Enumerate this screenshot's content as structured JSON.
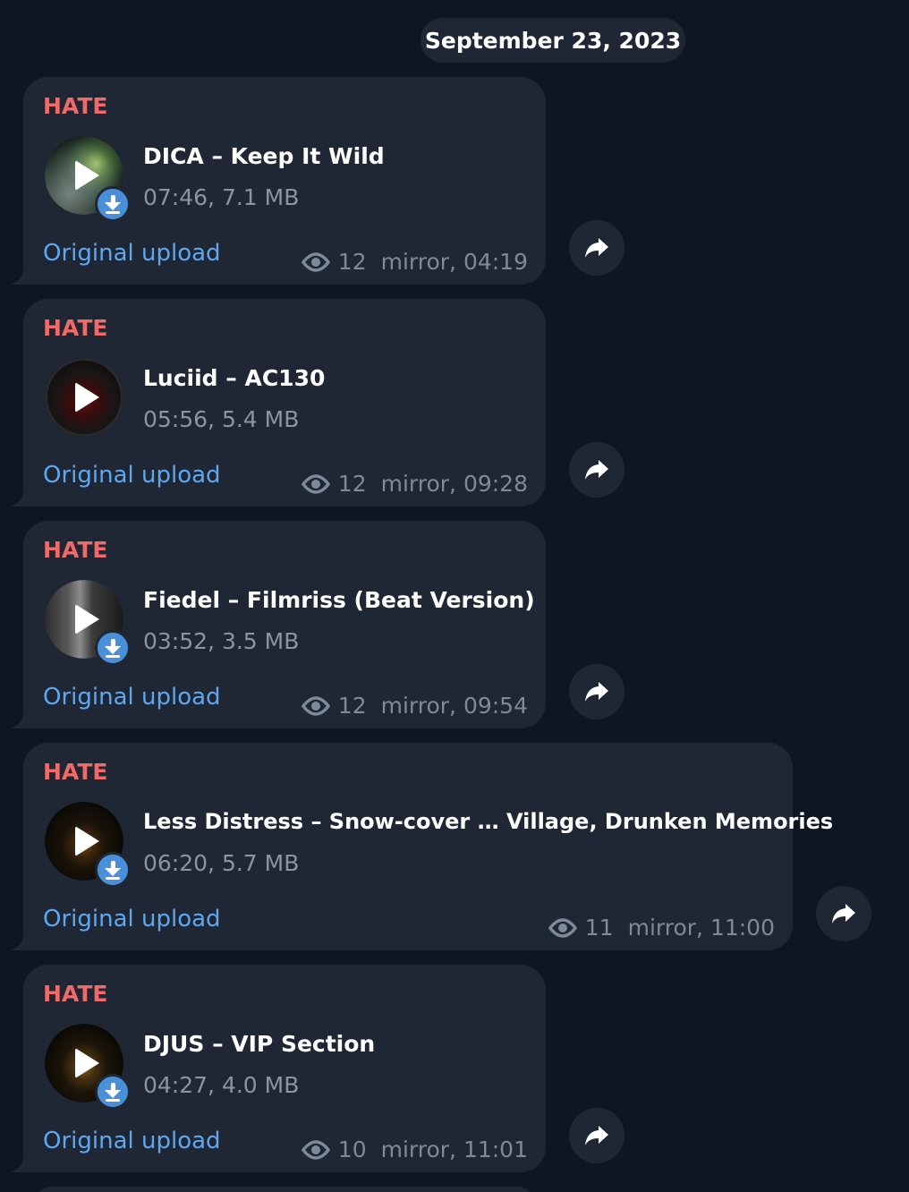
{
  "date_separator": "September 23, 2023",
  "colors": {
    "background": "#0f1621",
    "bubble": "#1e2733",
    "sender": "#ef6b69",
    "link": "#5ea8f0",
    "meta": "#8995a3",
    "download_badge": "#4a90d9"
  },
  "messages": [
    {
      "sender": "HATE",
      "title": "DICA – Keep It Wild",
      "meta": "07:46, 7.1 MB",
      "link": "Original upload",
      "views": "12",
      "time": "mirror, 04:19",
      "has_download": true,
      "art": "green-burst"
    },
    {
      "sender": "HATE",
      "title": "Luciid – AC130",
      "meta": "05:56, 5.4 MB",
      "link": "Original upload",
      "views": "12",
      "time": "mirror, 09:28",
      "has_download": false,
      "art": "red-emblem"
    },
    {
      "sender": "HATE",
      "title": "Fiedel – Filmriss (Beat Version)",
      "meta": "03:52, 3.5 MB",
      "link": "Original upload",
      "views": "12",
      "time": "mirror, 09:54",
      "has_download": true,
      "art": "grey-door"
    },
    {
      "sender": "HATE",
      "title": "Less Distress – Snow-cover … Village, Drunken Memories",
      "meta": "06:20, 5.7 MB",
      "link": "Original upload",
      "views": "11",
      "time": "mirror, 11:00",
      "has_download": true,
      "art": "dark-figure"
    },
    {
      "sender": "HATE",
      "title": "DJUS – VIP Section",
      "meta": "04:27, 4.0 MB",
      "link": "Original upload",
      "views": "10",
      "time": "mirror, 11:01",
      "has_download": true,
      "art": "dark-figure"
    }
  ],
  "icons": {
    "play": "play-icon",
    "download": "download-arrow-icon",
    "views": "eye-icon",
    "share": "share-arrow-icon"
  }
}
